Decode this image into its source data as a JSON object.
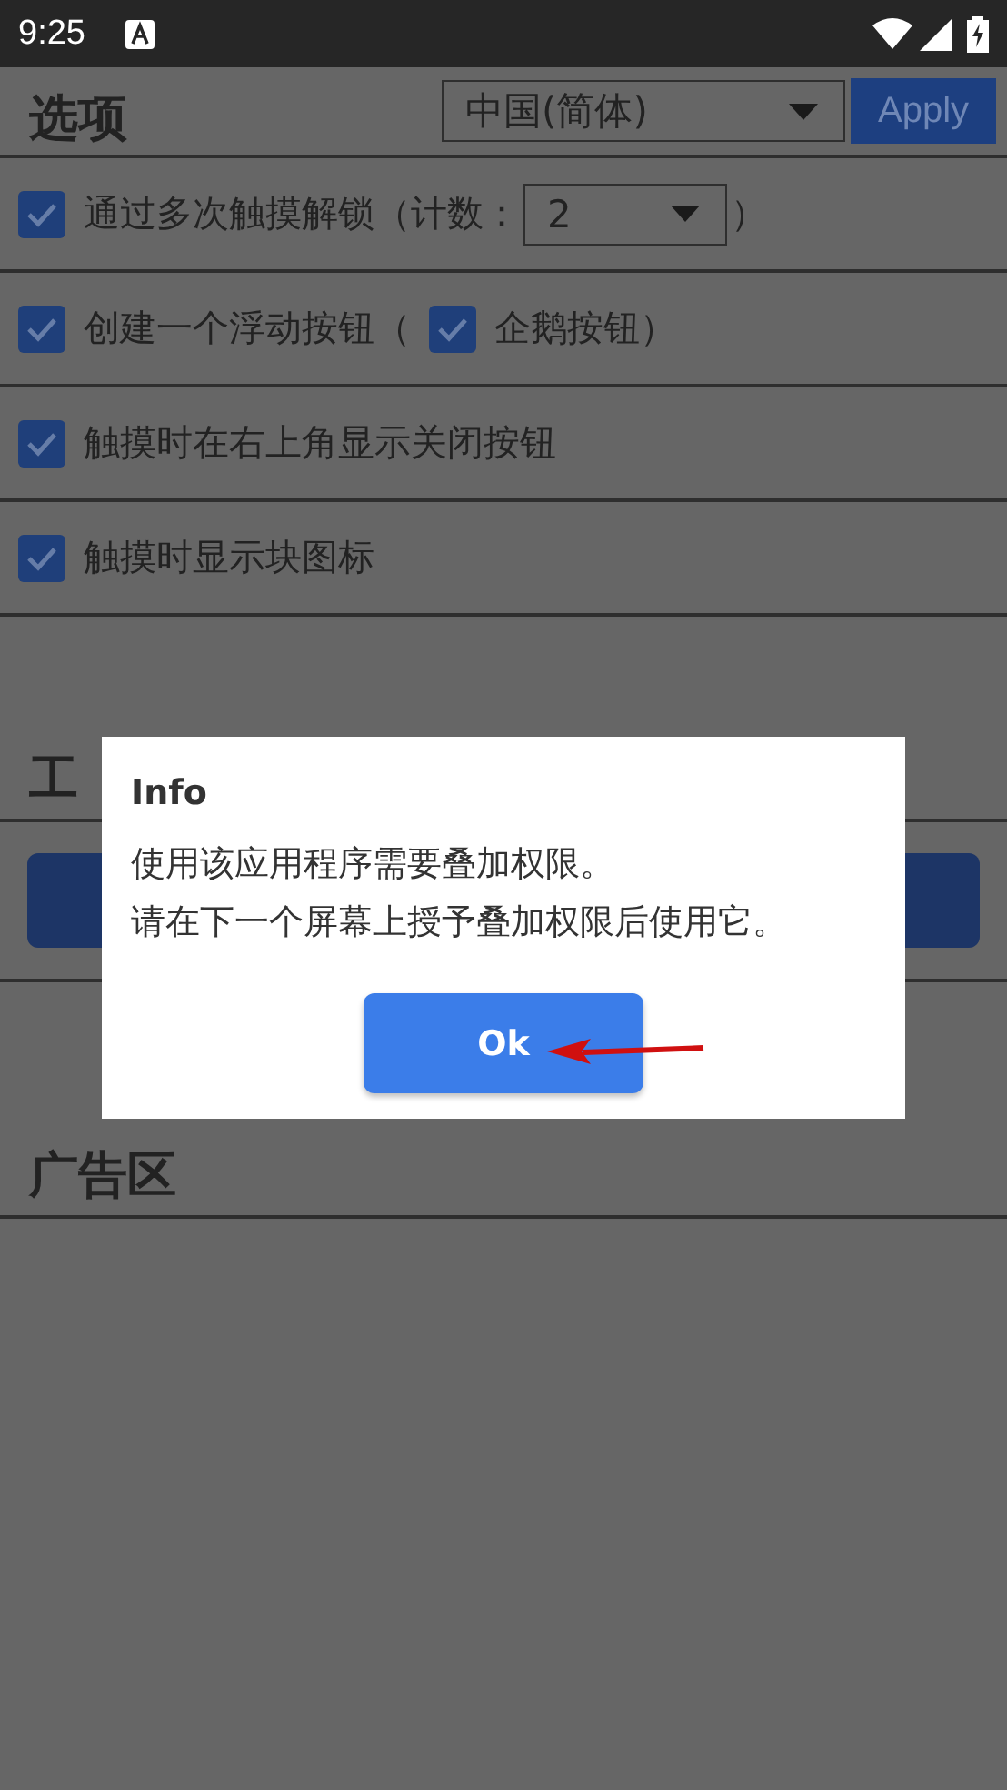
{
  "status_bar": {
    "time": "9:25"
  },
  "header": {
    "title": "选项",
    "language": "中国(简体)",
    "apply": "Apply"
  },
  "options": [
    {
      "kind": "count",
      "label": "通过多次触摸解锁（计数：",
      "count": "2",
      "suffix": "）",
      "checked": true
    },
    {
      "kind": "nested",
      "label": "创建一个浮动按钮（",
      "sub_label": "企鹅按钮）",
      "checked": true,
      "sub_checked": true
    },
    {
      "kind": "plain",
      "label": "触摸时在右上角显示关闭按钮",
      "checked": true
    },
    {
      "kind": "plain",
      "label": "触摸时显示块图标",
      "checked": true
    }
  ],
  "tools_section": {
    "title": "工"
  },
  "ad_section": {
    "title": "广告区"
  },
  "dialog": {
    "title": "Info",
    "message": [
      "使用该应用程序需要叠加权限。",
      "请在下一个屏幕上授予叠加权限后使用它。"
    ],
    "button": "Ok"
  }
}
